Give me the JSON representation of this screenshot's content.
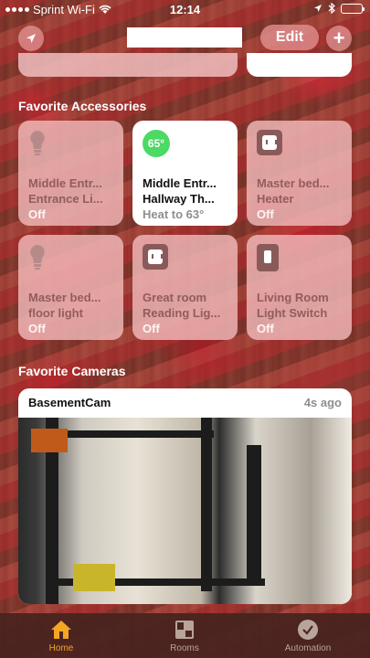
{
  "status_bar": {
    "carrier": "Sprint Wi-Fi",
    "time": "12:14"
  },
  "nav": {
    "edit_label": "Edit",
    "add_label": "+"
  },
  "sections": {
    "accessories_title": "Favorite Accessories",
    "cameras_title": "Favorite Cameras"
  },
  "accessories": [
    {
      "name_line1": "Middle Entr...",
      "name_line2": "Entrance Li...",
      "status": "Off",
      "icon": "lightbulb-icon"
    },
    {
      "name_line1": "Middle Entr...",
      "name_line2": "Hallway Th...",
      "status": "Heat to 63°",
      "icon": "thermostat-icon",
      "badge": "65°",
      "active": true
    },
    {
      "name_line1": "Master bed...",
      "name_line2": "Heater",
      "status": "Off",
      "icon": "outlet-icon"
    },
    {
      "name_line1": "Master bed...",
      "name_line2": "floor light",
      "status": "Off",
      "icon": "lightbulb-icon"
    },
    {
      "name_line1": "Great room",
      "name_line2": "Reading Lig...",
      "status": "Off",
      "icon": "outlet-icon"
    },
    {
      "name_line1": "Living Room",
      "name_line2": "Light Switch",
      "status": "Off",
      "icon": "switch-icon"
    }
  ],
  "camera": {
    "name": "BasementCam",
    "time_ago": "4s ago"
  },
  "tabs": [
    {
      "label": "Home",
      "icon": "house-icon",
      "selected": true
    },
    {
      "label": "Rooms",
      "icon": "rooms-icon"
    },
    {
      "label": "Automation",
      "icon": "clock-check-icon"
    }
  ],
  "colors": {
    "accent": "#f5a623",
    "badge_green": "#4cd964"
  }
}
